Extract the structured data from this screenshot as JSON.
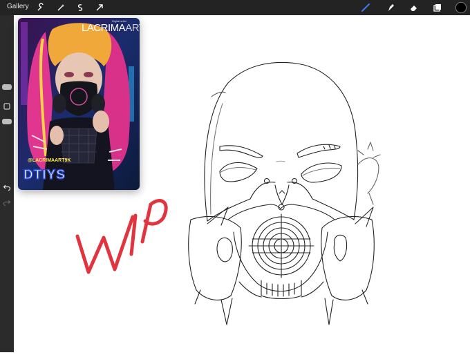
{
  "app": {
    "gallery_label": "Gallery"
  },
  "toolbar": {
    "left_icons": [
      "wrench-icon",
      "magic-wand-icon",
      "selection-icon",
      "transform-arrow-icon"
    ],
    "right_icons": [
      "brush-icon",
      "smudge-icon",
      "eraser-icon",
      "layers-icon",
      "color-swatch-icon"
    ],
    "brush_color": "#3b7bf5",
    "current_color": "#000000"
  },
  "reference_card": {
    "brand": "LACRIMA",
    "brand_suffix": "ART",
    "tagline": "Digital artist",
    "handle": "@LACRIMAART9K",
    "title": "DTIYS"
  },
  "canvas": {
    "annotation_text": "WIP",
    "annotation_color": "#e0353f"
  },
  "colors": {
    "topbar_bg": "#232323",
    "sidebar_bg": "#2b2b2b",
    "canvas_bg": "#ffffff"
  }
}
